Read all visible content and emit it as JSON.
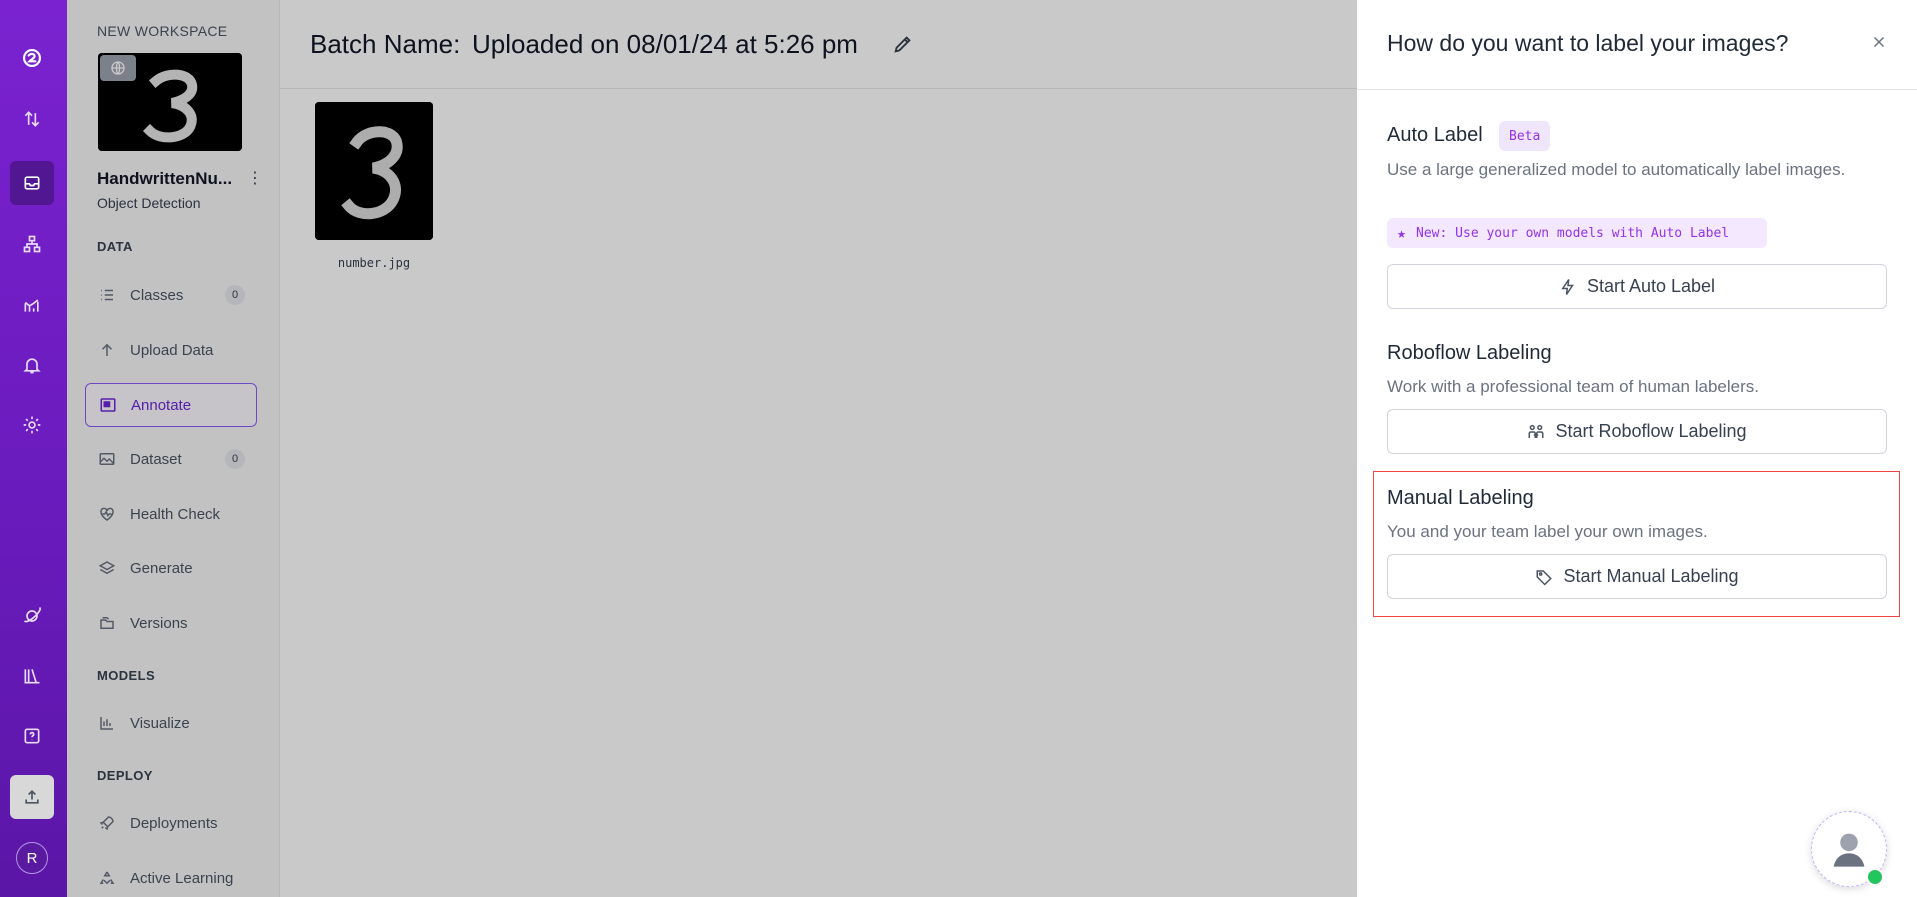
{
  "rail": {
    "avatar_letter": "R"
  },
  "sidebar": {
    "workspace_label": "NEW WORKSPACE",
    "project_name": "HandwrittenNu...",
    "project_type": "Object Detection",
    "sections": {
      "data": "DATA",
      "models": "MODELS",
      "deploy": "DEPLOY"
    },
    "items": [
      {
        "label": "Classes",
        "count": "0"
      },
      {
        "label": "Upload Data"
      },
      {
        "label": "Annotate"
      },
      {
        "label": "Dataset",
        "count": "0"
      },
      {
        "label": "Health Check"
      },
      {
        "label": "Generate"
      },
      {
        "label": "Versions"
      },
      {
        "label": "Visualize"
      },
      {
        "label": "Deployments"
      },
      {
        "label": "Active Learning"
      }
    ]
  },
  "main": {
    "batch_label": "Batch Name:",
    "batch_value": "Uploaded on 08/01/24 at 5:26 pm",
    "image_name": "number.jpg"
  },
  "drawer": {
    "title": "How do you want to label your images?",
    "auto_label": {
      "title": "Auto Label",
      "badge": "Beta",
      "description": "Use a large generalized model to automatically label images.",
      "new_badge": "New: Use your own models with Auto Label",
      "button": "Start Auto Label"
    },
    "roboflow_labeling": {
      "title": "Roboflow Labeling",
      "description": "Work with a professional team of human labelers.",
      "button": "Start Roboflow Labeling"
    },
    "manual_labeling": {
      "title": "Manual Labeling",
      "description": "You and your team label your own images.",
      "button": "Start Manual Labeling"
    }
  },
  "colors": {
    "brand": "#6a1bbd",
    "accent": "#8b5cf6",
    "highlight": "#ef4444",
    "online": "#22c55e"
  }
}
